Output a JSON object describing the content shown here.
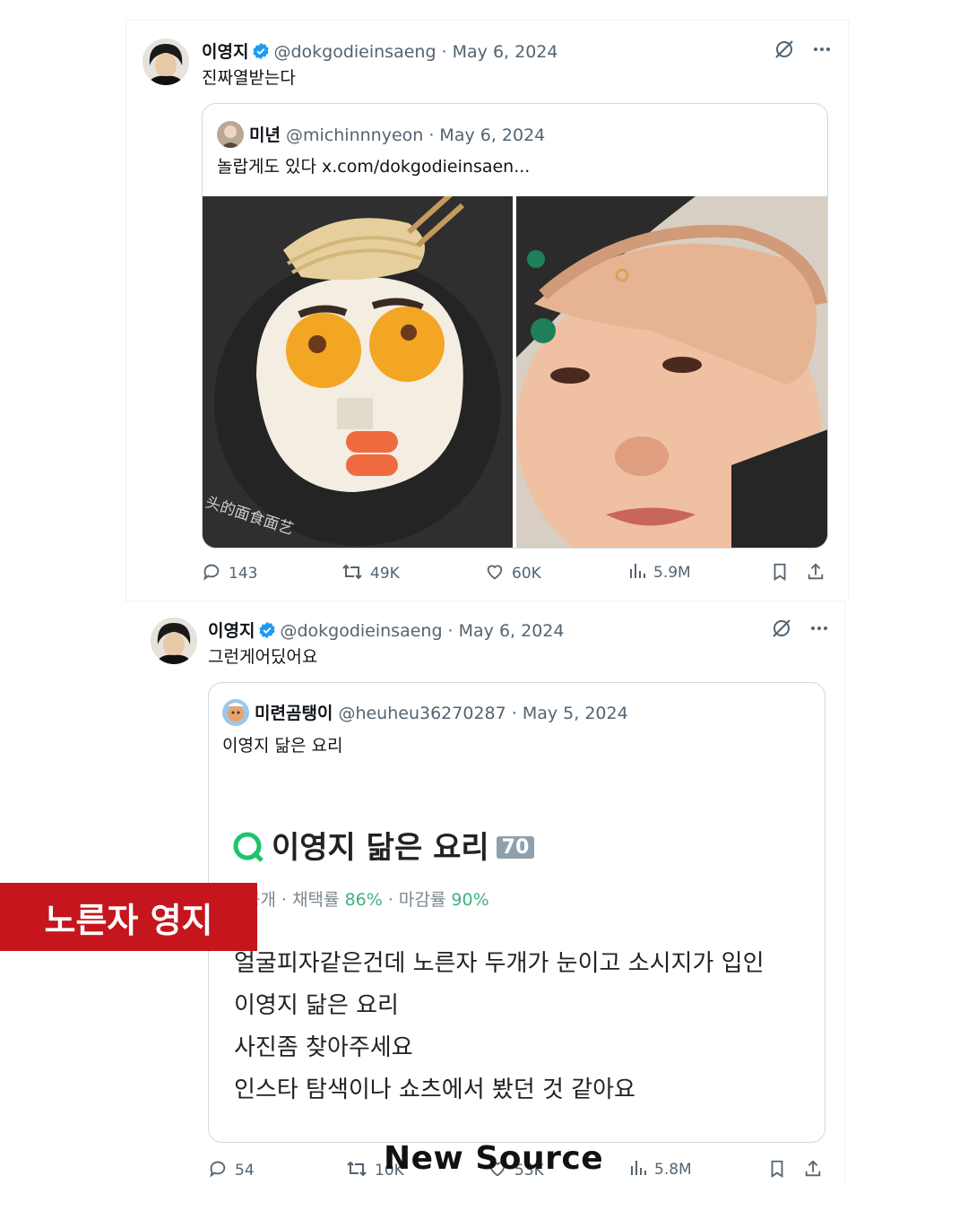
{
  "tweet1": {
    "author_name": "이영지",
    "author_handle": "@dokgodieinsaeng",
    "date": "May 6, 2024",
    "text": "진짜열받는다",
    "quote": {
      "author_name": "미년",
      "author_handle": "@michinnnyeon",
      "date": "May 6, 2024",
      "text": "놀랍게도 있다 x.com/dokgodieinsaen...",
      "media_watermark": "头的面食面艺"
    },
    "stats": {
      "replies": "143",
      "reposts": "49K",
      "likes": "60K",
      "views": "5.9M"
    }
  },
  "tweet2": {
    "author_name": "이영지",
    "author_handle": "@dokgodieinsaeng",
    "date": "May 6, 2024",
    "text": "그런게어딨어요",
    "quote": {
      "author_name": "미련곰탱이",
      "author_handle": "@heuheu36270287",
      "date": "May 5, 2024",
      "text": "이영지 닮은 요리",
      "qa": {
        "title": "이영지 닮은 요리",
        "badge": "70",
        "stats_prefix": "공개 · 채택률 ",
        "adopt_rate": "86%",
        "stats_mid": " · 마감률 ",
        "close_rate": "90%",
        "lines": [
          "얼굴피자같은건데 노른자 두개가 눈이고 소시지가 입인",
          "이영지 닮은 요리",
          "사진좀 찾아주세요",
          "인스타 탐색이나 쇼츠에서 봤던 것 같아요"
        ]
      }
    },
    "stats": {
      "replies": "54",
      "reposts": "10K",
      "likes": "53K",
      "views": "5.8M"
    }
  },
  "overlay": {
    "banner_text": "노른자 영지",
    "watermark": "New Source"
  },
  "colors": {
    "verified": "#1d9bf0",
    "banner": "#c4161c",
    "muted": "#536471",
    "green": "#3fb27f"
  },
  "icons": [
    "verified-badge-icon",
    "grok-icon",
    "more-icon",
    "reply-icon",
    "repost-icon",
    "like-icon",
    "views-icon",
    "bookmark-icon",
    "share-icon",
    "search-q-icon"
  ]
}
